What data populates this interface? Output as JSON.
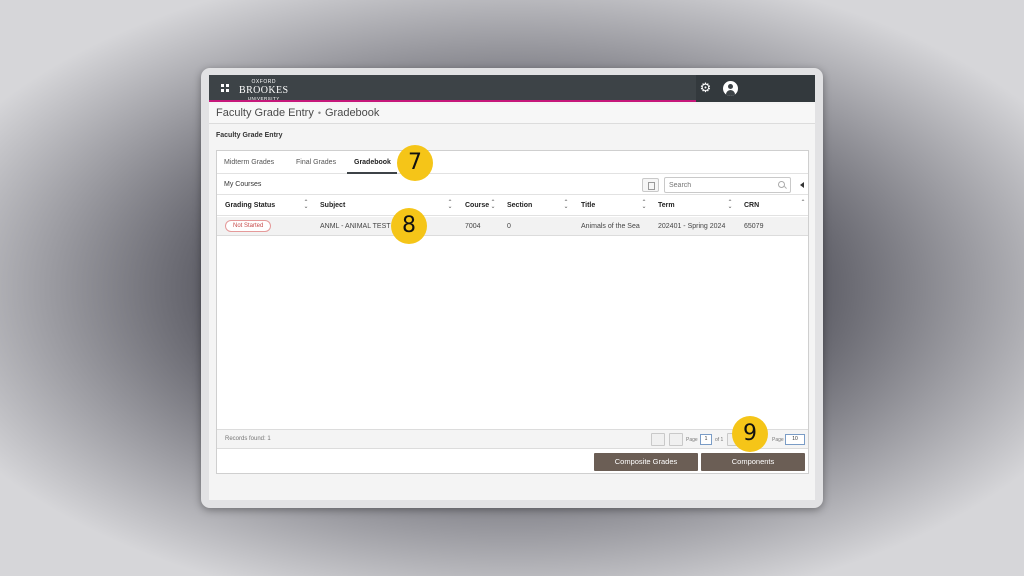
{
  "header": {
    "logo_line1": "OXFORD",
    "logo_line2": "BROOKES",
    "logo_line3": "UNIVERSITY",
    "icons": [
      "grid-icon",
      "gear-icon",
      "user-icon"
    ]
  },
  "breadcrumb": {
    "root": "Faculty Grade Entry",
    "separator": "•",
    "current": "Gradebook"
  },
  "section_title": "Faculty Grade Entry",
  "tabs": [
    {
      "label": "Midterm Grades",
      "active": false
    },
    {
      "label": "Final Grades",
      "active": false
    },
    {
      "label": "Gradebook",
      "active": true
    }
  ],
  "courses": {
    "label": "My Courses",
    "search_placeholder": "Search"
  },
  "table": {
    "columns": [
      "Grading Status",
      "Subject",
      "Course",
      "Section",
      "Title",
      "Term",
      "CRN"
    ],
    "rows": [
      {
        "status": "Not Started",
        "subject": "ANML - ANIMAL TEST",
        "course": "7004",
        "section": "0",
        "title": "Animals of the Sea",
        "term": "202401 - Spring 2024",
        "crn": "65079"
      }
    ]
  },
  "pagination": {
    "records_found": "Records found: 1",
    "page_label": "Page",
    "page_value": "1",
    "of_label": "of 1",
    "per_page_label": "Page",
    "per_page_value": "10"
  },
  "actions": {
    "composite_grades": "Composite Grades",
    "components": "Components"
  },
  "callouts": [
    "7",
    "8",
    "9"
  ],
  "colors": {
    "accent_bar": "#c6177a",
    "header_bg": "#3d4347",
    "button_bg": "#6b5e55",
    "callout": "#f5c518",
    "status_badge": "#c74b4b"
  }
}
